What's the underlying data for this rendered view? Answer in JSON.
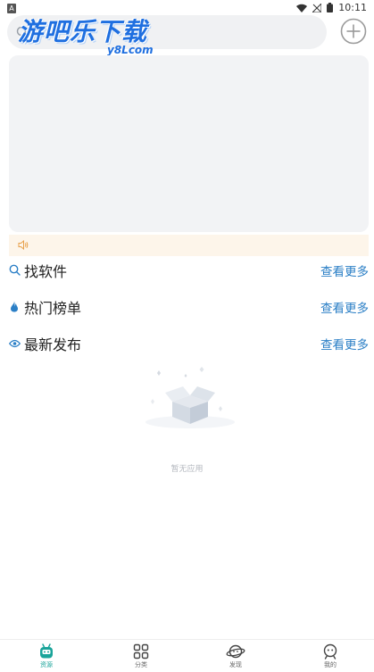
{
  "status_bar": {
    "time": "10:11",
    "app_icon": "A"
  },
  "header": {
    "logo_main": "游吧乐下载",
    "logo_sub": "y8Lcom",
    "add_icon": "plus-circle-icon"
  },
  "notice": {
    "icon": "speaker-icon",
    "text": ""
  },
  "sections": [
    {
      "title": "找软件",
      "more": "查看更多",
      "icon": "search-icon"
    },
    {
      "title": "热门榜单",
      "more": "查看更多",
      "icon": "flame-icon"
    },
    {
      "title": "最新发布",
      "more": "查看更多",
      "icon": "eye-icon"
    }
  ],
  "empty_state": {
    "text": "暂无应用"
  },
  "tabbar": {
    "tabs": [
      {
        "label": "资源",
        "icon": "robot-icon",
        "active": true
      },
      {
        "label": "分类",
        "icon": "grid-icon",
        "active": false
      },
      {
        "label": "发现",
        "icon": "planet-icon",
        "active": false
      },
      {
        "label": "我的",
        "icon": "smiley-icon",
        "active": false
      }
    ]
  },
  "colors": {
    "accent": "#2b7fc6",
    "active_tab": "#1aa49a",
    "logo": "#1f6fe0",
    "notice_bg": "#fdf5ea"
  }
}
